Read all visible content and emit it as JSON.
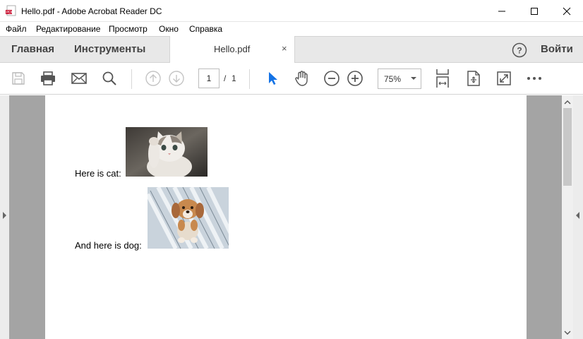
{
  "window": {
    "title": "Hello.pdf - Adobe Acrobat Reader DC"
  },
  "menu": [
    "Файл",
    "Редактирование",
    "Просмотр",
    "Окно",
    "Справка"
  ],
  "tabs": {
    "home": "Главная",
    "tools": "Инструменты",
    "document": "Hello.pdf",
    "close": "×"
  },
  "header": {
    "help": "?",
    "signin": "Войти"
  },
  "toolbar": {
    "icons": [
      "save-icon",
      "print-icon",
      "email-icon",
      "search-icon",
      "page-up-icon",
      "page-down-icon",
      "select-arrow-icon",
      "hand-icon",
      "zoom-out-icon",
      "zoom-in-icon",
      "fit-page-icon",
      "rotate-view-icon",
      "fullscreen-icon",
      "more-icon"
    ],
    "page_current": "1",
    "page_separator": "/",
    "page_total": "1",
    "zoom": "75%"
  },
  "document": {
    "cat_text": "Here is cat:",
    "dog_text": "And here is dog:"
  },
  "colors": {
    "pdf_red": "#c8102e",
    "select_blue": "#1473e6",
    "page_bg": "#ffffff",
    "canvas_bg": "#a4a4a4"
  }
}
